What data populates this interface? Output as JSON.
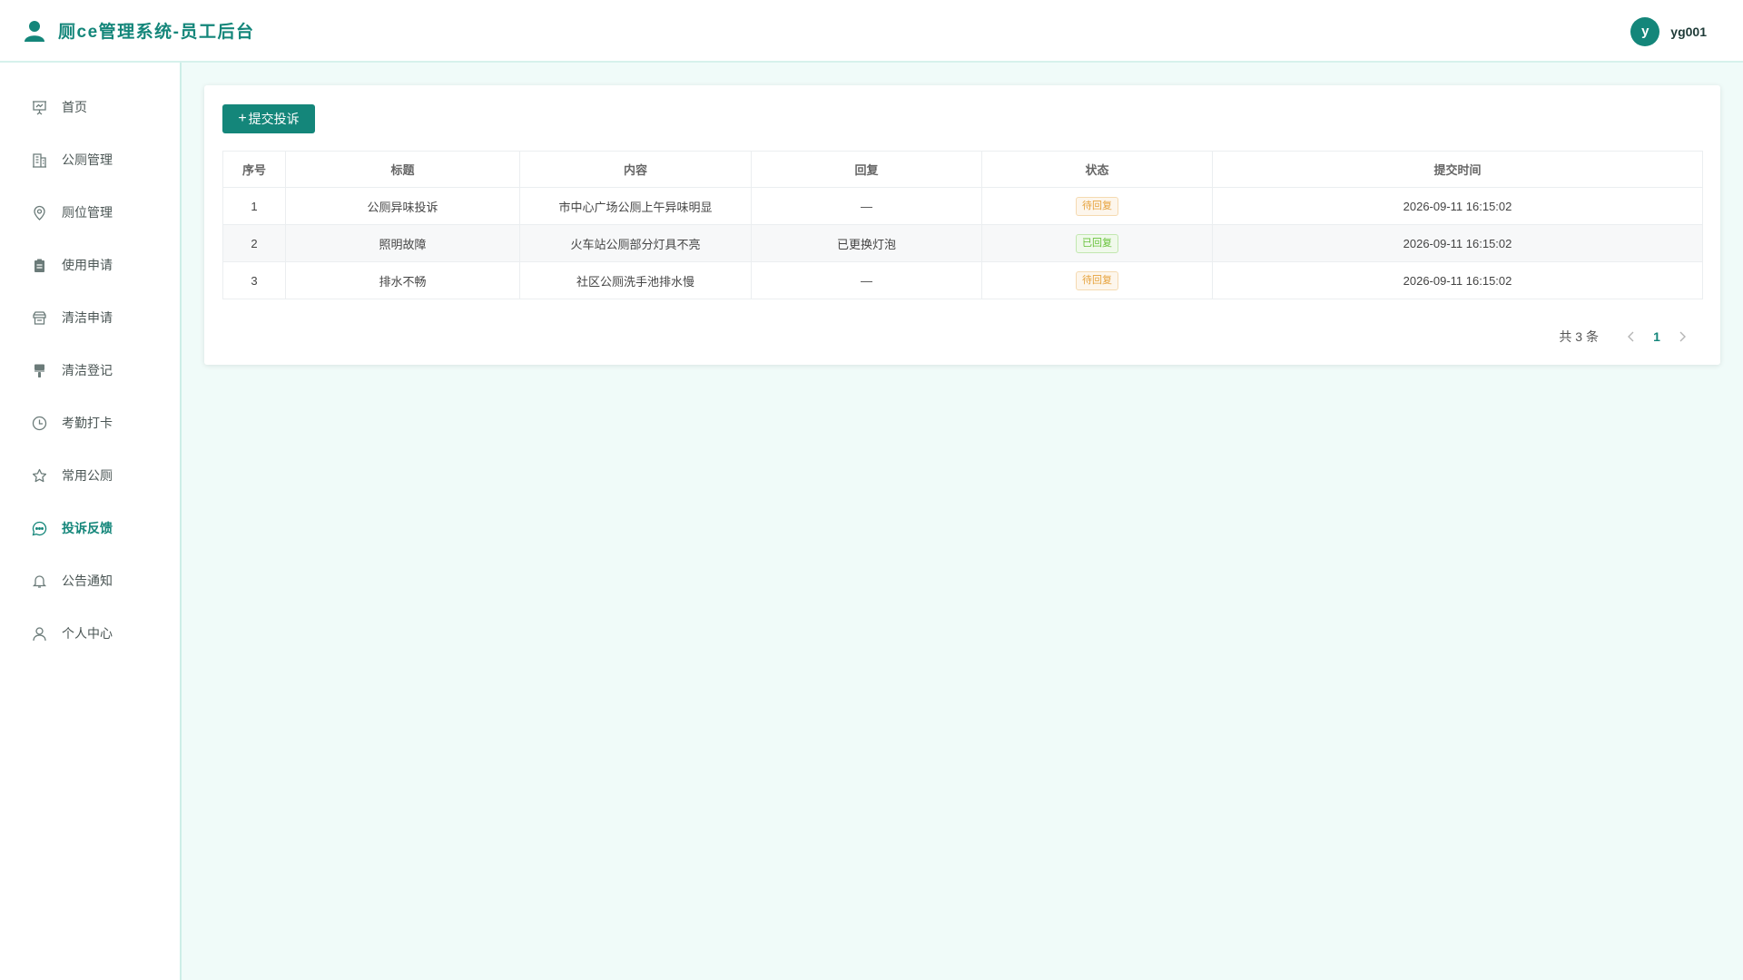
{
  "app": {
    "title": "厕ce管理系统-员工后台",
    "brand_color": "#14867a"
  },
  "user": {
    "avatar_letter": "y",
    "name": "yg001"
  },
  "sidebar": {
    "items": [
      {
        "label": "首页",
        "icon": "presentation-icon",
        "active": false
      },
      {
        "label": "公厕管理",
        "icon": "building-icon",
        "active": false
      },
      {
        "label": "厕位管理",
        "icon": "location-pin-icon",
        "active": false
      },
      {
        "label": "使用申请",
        "icon": "clipboard-icon",
        "active": false
      },
      {
        "label": "清洁申请",
        "icon": "box-icon",
        "active": false
      },
      {
        "label": "清洁登记",
        "icon": "brush-icon",
        "active": false
      },
      {
        "label": "考勤打卡",
        "icon": "clock-icon",
        "active": false
      },
      {
        "label": "常用公厕",
        "icon": "star-icon",
        "active": false
      },
      {
        "label": "投诉反馈",
        "icon": "chat-icon",
        "active": true
      },
      {
        "label": "公告通知",
        "icon": "bell-icon",
        "active": false
      },
      {
        "label": "个人中心",
        "icon": "user-icon",
        "active": false
      }
    ]
  },
  "toolbar": {
    "submit_label": "提交投诉"
  },
  "table": {
    "columns": [
      "序号",
      "标题",
      "内容",
      "回复",
      "状态",
      "提交时间"
    ],
    "rows": [
      {
        "index": "1",
        "title": "公厕异味投诉",
        "content": "市中心广场公厕上午异味明显",
        "reply": "—",
        "status": "待回复",
        "status_type": "warning",
        "time": "2026-09-11 16:15:02"
      },
      {
        "index": "2",
        "title": "照明故障",
        "content": "火车站公厕部分灯具不亮",
        "reply": "已更换灯泡",
        "status": "已回复",
        "status_type": "success",
        "time": "2026-09-11 16:15:02"
      },
      {
        "index": "3",
        "title": "排水不畅",
        "content": "社区公厕洗手池排水慢",
        "reply": "—",
        "status": "待回复",
        "status_type": "warning",
        "time": "2026-09-11 16:15:02"
      }
    ]
  },
  "pagination": {
    "total_text": "共 3 条",
    "current_page": "1"
  }
}
